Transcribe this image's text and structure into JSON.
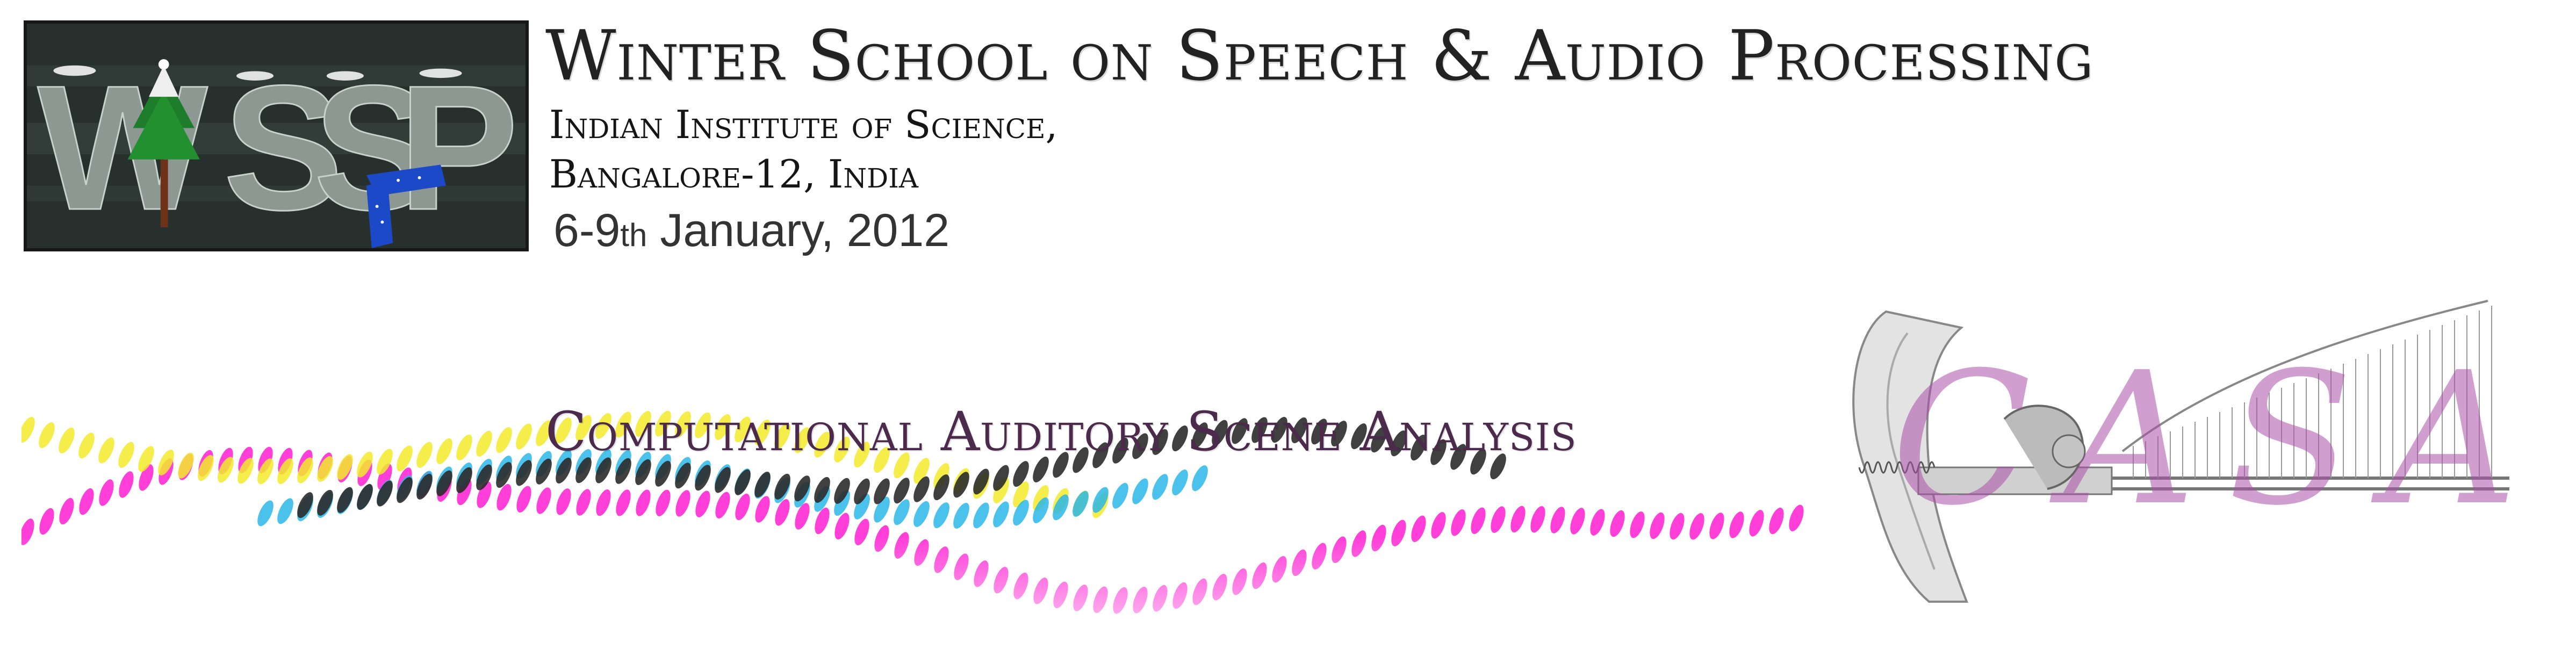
{
  "header": {
    "title": "Winter School on Speech & Audio Processing",
    "institute_line1": "Indian Institute of Science,",
    "institute_line2": "Bangalore-12, India",
    "date_days": "6-9",
    "date_suffix": "th",
    "date_rest": "January, 2012"
  },
  "logo": {
    "text": "WiSSAP"
  },
  "banner": {
    "subtitle": "Computational Auditory Scene Analysis",
    "ear_text": "CASA"
  },
  "colors": {
    "magenta": "#ff2ad4",
    "yellow": "#f2ea2a",
    "cyan": "#2ab7e8",
    "black": "#2b2b2b",
    "title_text": "#222222",
    "subtitle_text": "#4b2a4c",
    "ear_text": "#aa50aa"
  },
  "icons": {
    "logo_tree": "tree-icon",
    "logo_scarf": "scarf-icon",
    "ear_diagram": "ear-anatomy-icon"
  }
}
